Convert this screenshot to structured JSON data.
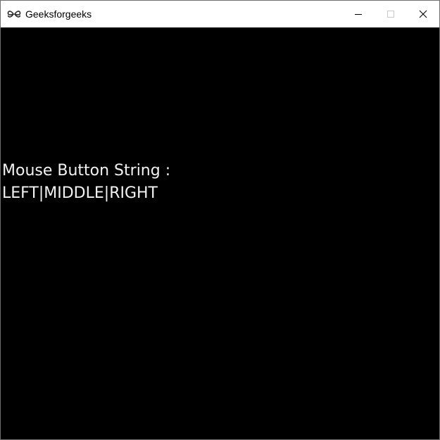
{
  "window": {
    "title": "Geeksforgeeks",
    "icon": "geeksforgeeks-logo-icon",
    "controls": {
      "minimize_icon": "minimize-icon",
      "maximize_icon": "maximize-icon",
      "close_icon": "close-icon"
    }
  },
  "canvas": {
    "background": "#000000",
    "text_color": "#f2f2f2",
    "label": "Mouse Button String  :",
    "value": "LEFT|MIDDLE|RIGHT"
  }
}
